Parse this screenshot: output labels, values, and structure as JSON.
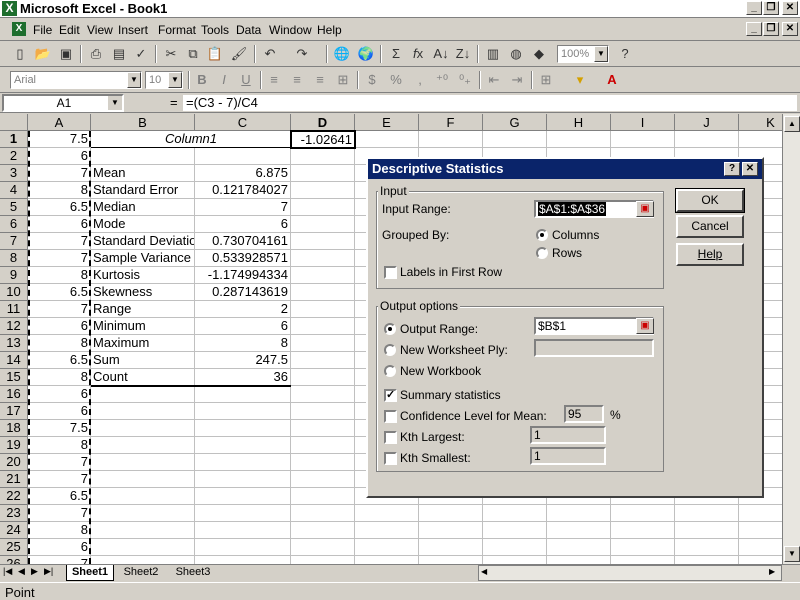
{
  "window": {
    "title": "Microsoft Excel - Book1"
  },
  "menu": [
    "File",
    "Edit",
    "View",
    "Insert",
    "Format",
    "Tools",
    "Data",
    "Window",
    "Help"
  ],
  "toolbar": {
    "zoom": "100%",
    "font": "Arial",
    "size": "10",
    "bold": "B",
    "italic": "I",
    "underline": "U",
    "currency": "$",
    "percent": "%",
    "comma": ","
  },
  "formula": {
    "namebox": "A1",
    "eq": "=",
    "content": "=(C3 - 7)/C4"
  },
  "columns": [
    "A",
    "B",
    "C",
    "D",
    "E",
    "F",
    "G",
    "H",
    "I",
    "J",
    "K"
  ],
  "rows": [
    "1",
    "2",
    "3",
    "4",
    "5",
    "6",
    "7",
    "8",
    "9",
    "10",
    "11",
    "12",
    "13",
    "14",
    "15",
    "16",
    "17",
    "18",
    "19",
    "20",
    "21",
    "22",
    "23",
    "24",
    "25",
    "26"
  ],
  "colA": [
    "7.5",
    "6",
    "7",
    "8",
    "6.5",
    "6",
    "7",
    "7",
    "8",
    "6.5",
    "7",
    "6",
    "8",
    "6.5",
    "8",
    "6",
    "6",
    "7.5",
    "8",
    "7",
    "7",
    "6.5",
    "7",
    "8",
    "6",
    "7"
  ],
  "stats": {
    "header": "Column1",
    "labels": [
      "Mean",
      "Standard Error",
      "Median",
      "Mode",
      "Standard Deviatio",
      "Sample Variance",
      "Kurtosis",
      "Skewness",
      "Range",
      "Minimum",
      "Maximum",
      "Sum",
      "Count"
    ],
    "values": [
      "6.875",
      "0.121784027",
      "7",
      "6",
      "0.730704161",
      "0.533928571",
      "-1.174994334",
      "0.287143619",
      "2",
      "6",
      "8",
      "247.5",
      "36"
    ]
  },
  "d1": "-1.02641",
  "dialog": {
    "title": "Descriptive Statistics",
    "help_q": "?",
    "close": "✕",
    "input_group": "Input",
    "input_range_label": "Input Range:",
    "input_range": "$A$1:$A$36",
    "grouped_by": "Grouped By:",
    "columns_opt": "Columns",
    "rows_opt": "Rows",
    "labels_first_row": "Labels in First Row",
    "output_group": "Output options",
    "output_range_label": "Output Range:",
    "output_range": "$B$1",
    "new_ply": "New Worksheet Ply:",
    "new_workbook": "New Workbook",
    "summary": "Summary statistics",
    "confidence": "Confidence Level for Mean:",
    "confidence_val": "95",
    "pct": "%",
    "kth_largest": "Kth Largest:",
    "kth_largest_val": "1",
    "kth_smallest": "Kth Smallest:",
    "kth_smallest_val": "1",
    "ok": "OK",
    "cancel": "Cancel",
    "help": "Help"
  },
  "tabs": [
    "Sheet1",
    "Sheet2",
    "Sheet3"
  ],
  "status": "Point",
  "colors": {
    "dialog_title": "#0a246a",
    "face": "#d4d0c8"
  }
}
